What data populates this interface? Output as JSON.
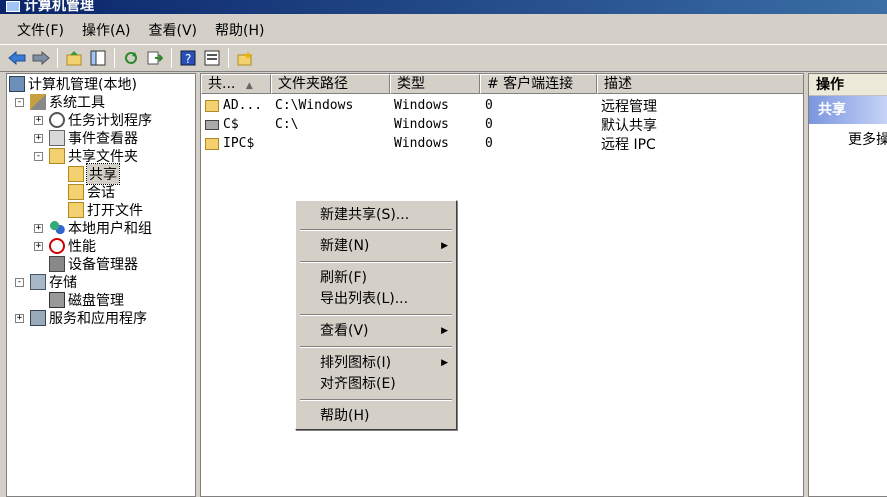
{
  "window": {
    "title": "计算机管理"
  },
  "menu": [
    "文件(F)",
    "操作(A)",
    "查看(V)",
    "帮助(H)"
  ],
  "toolbar": {
    "buttons": [
      "back-icon",
      "forward-icon",
      "up-icon",
      "show-hide-tree-icon",
      "refresh-icon",
      "export-icon",
      "help-icon",
      "properties-icon",
      "new-share-icon"
    ]
  },
  "tree": {
    "root": "计算机管理(本地)",
    "system_tools": "系统工具",
    "task_scheduler": "任务计划程序",
    "event_viewer": "事件查看器",
    "shared_folders": "共享文件夹",
    "shares": "共享",
    "sessions": "会话",
    "open_files": "打开文件",
    "local_users": "本地用户和组",
    "performance": "性能",
    "device_manager": "设备管理器",
    "storage": "存储",
    "disk_management": "磁盘管理",
    "services": "服务和应用程序",
    "expander_plus": "+",
    "expander_minus": "-"
  },
  "list": {
    "columns": [
      "共...",
      "文件夹路径",
      "类型",
      "# 客户端连接",
      "描述"
    ],
    "sort_arrow": "▲",
    "rows": [
      {
        "name": "AD...",
        "path": "C:\\Windows",
        "type": "Windows",
        "clients": "0",
        "desc": "远程管理"
      },
      {
        "name": "C$",
        "path": "C:\\",
        "type": "Windows",
        "clients": "0",
        "desc": "默认共享"
      },
      {
        "name": "IPC$",
        "path": "",
        "type": "Windows",
        "clients": "0",
        "desc": "远程 IPC"
      }
    ]
  },
  "actions": {
    "title": "操作",
    "section": "共享",
    "more": "更多操作"
  },
  "context_menu": {
    "new_share": "新建共享(S)...",
    "new": "新建(N)",
    "refresh": "刷新(F)",
    "export_list": "导出列表(L)...",
    "view": "查看(V)",
    "arrange_icons": "排列图标(I)",
    "align_icons": "对齐图标(E)",
    "help": "帮助(H)",
    "submenu_arrow": "▶"
  }
}
